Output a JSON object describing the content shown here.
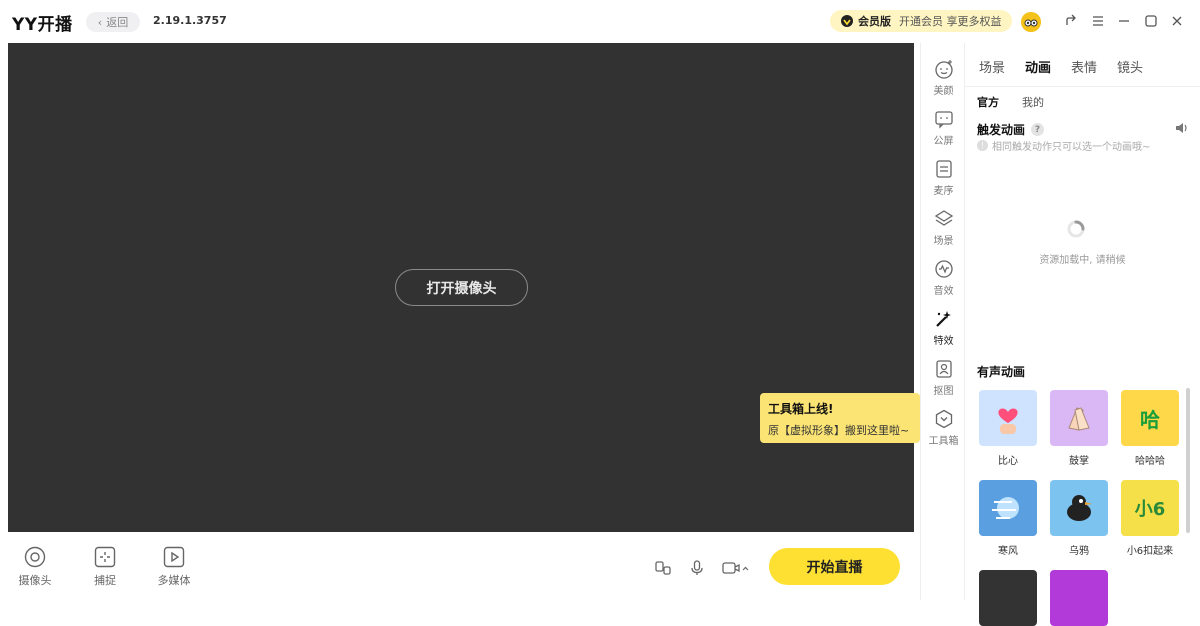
{
  "app": {
    "title": "YY开播",
    "back_label": "返回",
    "version": "2.19.1.3757"
  },
  "vip": {
    "badge": "会员版",
    "promo": "开通会员 享更多权益"
  },
  "stage": {
    "open_camera_label": "打开摄像头"
  },
  "tooltip": {
    "title": "工具箱上线!",
    "body": "原【虚拟形象】搬到这里啦~"
  },
  "bottom": {
    "tools": [
      {
        "label": "摄像头",
        "icon": "camera-lens-icon"
      },
      {
        "label": "捕捉",
        "icon": "capture-icon"
      },
      {
        "label": "多媒体",
        "icon": "media-play-icon"
      }
    ],
    "start_label": "开始直播"
  },
  "sidenav": {
    "items": [
      {
        "label": "美颜",
        "icon": "beauty-face-icon"
      },
      {
        "label": "公屏",
        "icon": "chat-screen-icon"
      },
      {
        "label": "麦序",
        "icon": "mic-queue-icon"
      },
      {
        "label": "场景",
        "icon": "layers-icon"
      },
      {
        "label": "音效",
        "icon": "sound-wave-icon"
      },
      {
        "label": "特效",
        "icon": "magic-wand-icon"
      },
      {
        "label": "抠图",
        "icon": "cutout-portrait-icon"
      },
      {
        "label": "工具箱",
        "icon": "toolbox-hex-icon"
      }
    ],
    "active_index": 5
  },
  "panel": {
    "tabs": [
      "场景",
      "动画",
      "表情",
      "镜头"
    ],
    "active_tab": 1,
    "subtabs": [
      "官方",
      "我的"
    ],
    "active_subtab": 0,
    "trigger_title": "触发动画",
    "help_mark": "?",
    "notice_mark": "!",
    "notice": "相同触发动作只可以选一个动画哦~",
    "loading": "资源加载中, 请稍候",
    "sound_title": "有声动画",
    "animations": [
      {
        "label": "比心",
        "thumb_text": "",
        "bg": "#cfe3ff"
      },
      {
        "label": "鼓掌",
        "thumb_text": "",
        "bg": "#d9b8f5"
      },
      {
        "label": "哈哈哈",
        "thumb_text": "哈",
        "bg": "#ffd84a"
      },
      {
        "label": "寒风",
        "thumb_text": "",
        "bg": "#5a9fe0"
      },
      {
        "label": "乌鸦",
        "thumb_text": "",
        "bg": "#7cc3f0"
      },
      {
        "label": "小6扣起来",
        "thumb_text": "小6",
        "bg": "#f5e04a"
      },
      {
        "label": "",
        "thumb_text": "",
        "bg": "#333333"
      },
      {
        "label": "",
        "thumb_text": "",
        "bg": "#b23ad9"
      }
    ]
  },
  "colors": {
    "accent": "#fde031",
    "stage_bg": "#323232",
    "tooltip_bg": "#fbe474"
  }
}
